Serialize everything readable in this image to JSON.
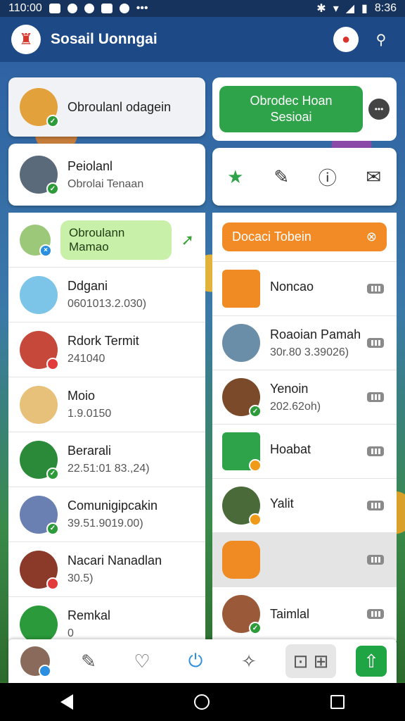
{
  "status": {
    "time": "110:00",
    "clock_right": "8:36"
  },
  "appbar": {
    "title": "Sosail Uonngai"
  },
  "left": {
    "top_card": {
      "name": "Obroulanl odagein"
    },
    "profile_card": {
      "name": "Peiolanl",
      "sub": "Obrolai Tenaan"
    },
    "pill_row": {
      "label": "Obroulann Mamao"
    },
    "rows": [
      {
        "name": "Ddgani",
        "sub": "0601013.2.030)",
        "avatar_color": "#7cc4e8",
        "badge": ""
      },
      {
        "name": "Rdork Termit",
        "sub": "241040",
        "avatar_color": "#c5483a",
        "badge": "red"
      },
      {
        "name": "Moio",
        "sub": "1.9.0150",
        "avatar_color": "#e7c17a",
        "badge": ""
      },
      {
        "name": "Berarali",
        "sub": "22.51:01 83.,24)",
        "avatar_color": "#2a8a3a",
        "badge": "green"
      },
      {
        "name": "Comunigipcakin",
        "sub": "39.51.9019.00)",
        "avatar_color": "#6a7fb2",
        "badge": "green"
      },
      {
        "name": "Nacari Nanadlan",
        "sub": "30.5)",
        "avatar_color": "#8b3a2a",
        "badge": "red"
      },
      {
        "name": "Remkal",
        "sub": "0",
        "avatar_color": "#2a9a3a",
        "badge": ""
      }
    ]
  },
  "right": {
    "top_card": {
      "line1": "Obrodec Hoan",
      "line2": "Sesioai"
    },
    "orange_pill": {
      "label": "Docaci Tobein"
    },
    "rows": [
      {
        "name": "Noncao",
        "sub": "",
        "avatar_color": "#f08a22"
      },
      {
        "name": "Roaoian Pamah",
        "sub": "30r.80 3.39026)",
        "avatar_color": "#6a8ea8"
      },
      {
        "name": "Yenoin",
        "sub": "202.62oh)",
        "avatar_color": "#7b4a2a"
      },
      {
        "name": "Hoabat",
        "sub": "",
        "avatar_color": "#2ea34a"
      },
      {
        "name": "Yalit",
        "sub": "",
        "avatar_color": "#4a6a3a"
      },
      {
        "name": "",
        "sub": "",
        "avatar_color": "#f08a22"
      },
      {
        "name": "Taimlal",
        "sub": "",
        "avatar_color": "#9a5a3a"
      }
    ]
  },
  "colors": {
    "appbar": "#1d4a86",
    "accent_green": "#2fa34a",
    "accent_orange": "#f28a26"
  }
}
